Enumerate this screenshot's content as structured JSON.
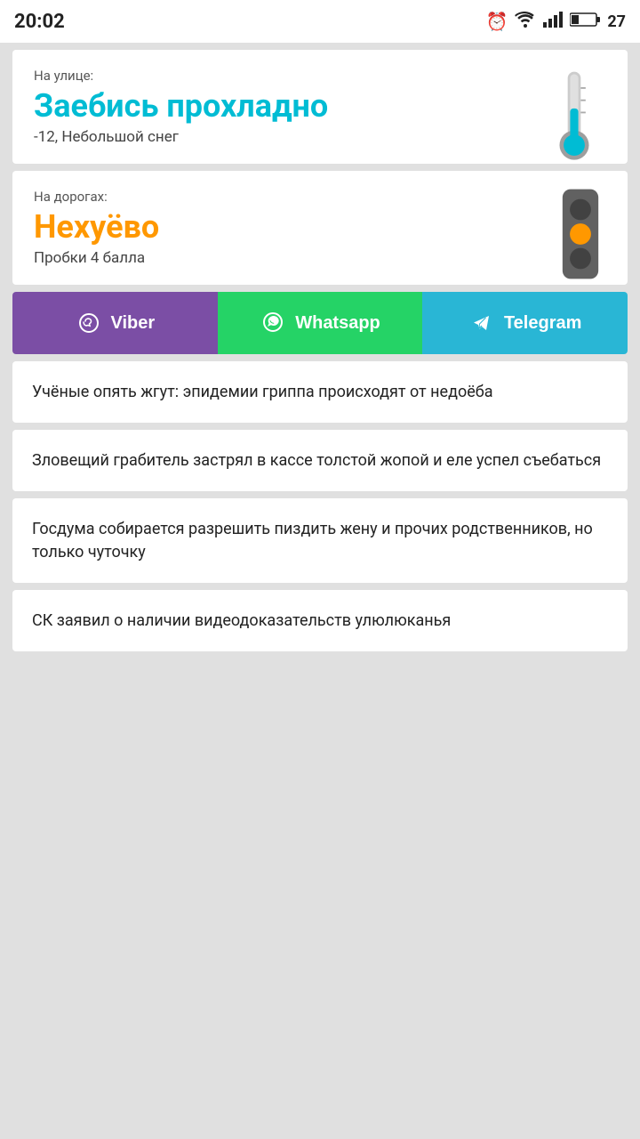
{
  "statusBar": {
    "time": "20:02",
    "battery": "27"
  },
  "weatherCard": {
    "label": "На улице:",
    "title": "Заебись прохладно",
    "subtitle": "-12, Небольшой снег"
  },
  "roadsCard": {
    "label": "На дорогах:",
    "title": "Нехуёво",
    "subtitle": "Пробки 4 балла"
  },
  "shareButtons": {
    "viber": "Viber",
    "whatsapp": "Whatsapp",
    "telegram": "Telegram"
  },
  "newsItems": [
    {
      "text": "Учёные опять жгут: эпидемии гриппа происходят от недоёба"
    },
    {
      "text": "Зловещий грабитель застрял в кассе толстой жопой и еле успел съебаться"
    },
    {
      "text": "Госдума собирается разрешить пиздить жену и прочих родственников, но только чуточку"
    },
    {
      "text": "СК заявил о наличии видеодоказательств улюлюканья"
    }
  ],
  "colors": {
    "viber": "#7b4ea5",
    "whatsapp": "#25d366",
    "telegram": "#29b6d5",
    "cyan": "#00bcd4",
    "orange": "#ff9800"
  }
}
